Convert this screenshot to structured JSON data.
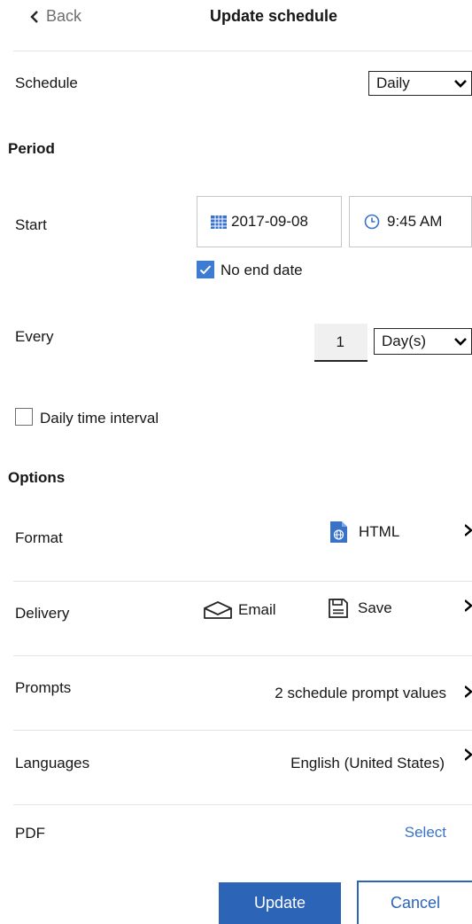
{
  "header": {
    "back_label": "Back",
    "title": "Update schedule"
  },
  "schedule": {
    "label": "Schedule",
    "value": "Daily"
  },
  "period": {
    "heading": "Period",
    "start_label": "Start",
    "start_date": "2017-09-08",
    "start_time": "9:45 AM",
    "no_end_date_label": "No end date",
    "no_end_date_checked": true,
    "every_label": "Every",
    "every_value": "1",
    "every_unit": "Day(s)",
    "daily_interval_label": "Daily time interval",
    "daily_interval_checked": false
  },
  "options": {
    "heading": "Options",
    "format": {
      "label": "Format",
      "value": "HTML"
    },
    "delivery": {
      "label": "Delivery",
      "email": "Email",
      "save": "Save"
    },
    "prompts": {
      "label": "Prompts",
      "value": "2 schedule prompt values"
    },
    "languages": {
      "label": "Languages",
      "value": "English (United States)"
    },
    "pdf": {
      "label": "PDF",
      "action": "Select"
    }
  },
  "actions": {
    "update_label": "Update",
    "cancel_label": "Cancel"
  },
  "colors": {
    "primary": "#2c64b8",
    "link": "#3b73c7",
    "checkbox": "#3e7bd3",
    "divider": "#e3e3e3"
  },
  "icons": [
    "chevron-left-icon",
    "chevron-down-icon",
    "calendar-icon",
    "clock-icon",
    "checkmark-icon",
    "html-file-icon",
    "envelope-icon",
    "save-icon",
    "chevron-right-icon"
  ]
}
